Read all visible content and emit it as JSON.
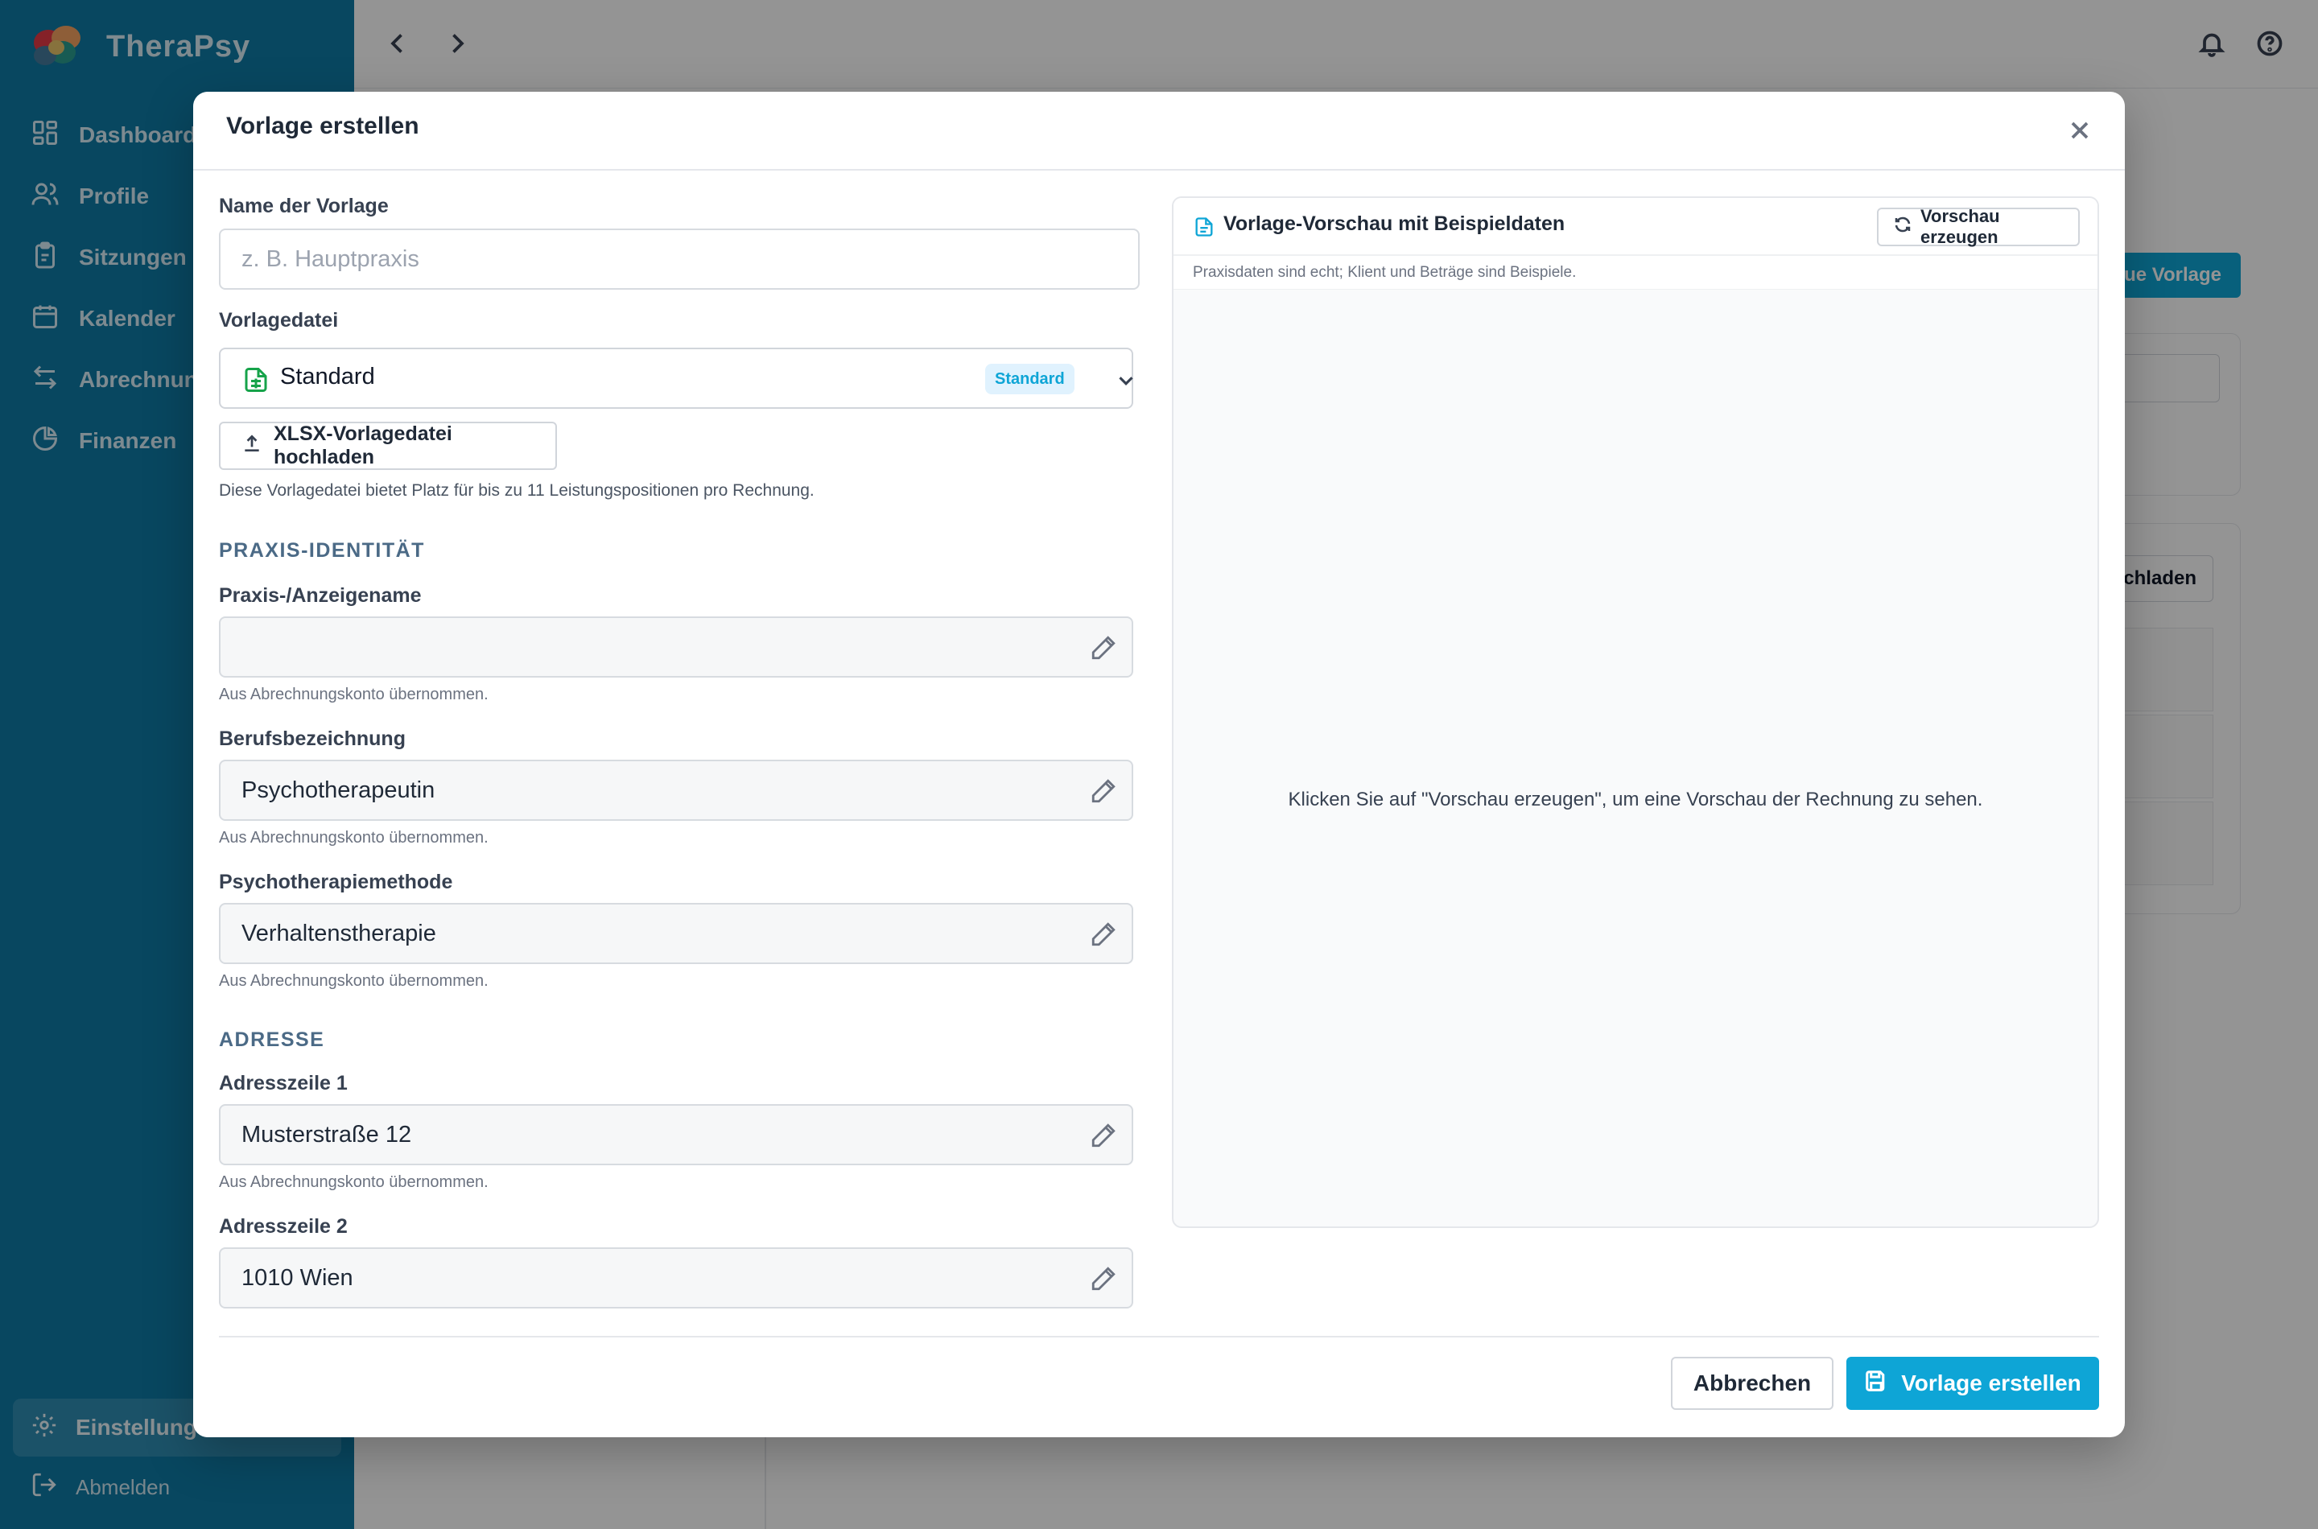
{
  "app": {
    "brand": "TheraPsy"
  },
  "sidebar": {
    "items": [
      {
        "label": "Dashboard",
        "icon": "dashboard-icon"
      },
      {
        "label": "Profile",
        "icon": "users-icon"
      },
      {
        "label": "Sitzungen",
        "icon": "clipboard-icon"
      },
      {
        "label": "Kalender",
        "icon": "calendar-icon"
      },
      {
        "label": "Abrechnung",
        "icon": "arrows-icon"
      },
      {
        "label": "Finanzen",
        "icon": "pie-chart-icon"
      }
    ],
    "active_bottom": {
      "label": "Einstellung",
      "icon": "gear-icon"
    },
    "logout": {
      "label": "Abmelden",
      "icon": "logout-icon"
    }
  },
  "background": {
    "new_button_label": "ue Vorlage",
    "upload_button_label": "chladen"
  },
  "modal": {
    "title": "Vorlage erstellen",
    "name_label": "Name der Vorlage",
    "name_placeholder": "z. B. Hauptpraxis",
    "name_value": "",
    "template_label": "Vorlagedatei",
    "template_value": "Standard",
    "template_badge": "Standard",
    "upload_label": "XLSX-Vorlagedatei hochladen",
    "template_hint": "Diese Vorlagedatei bietet Platz für bis zu 11 Leistungspositionen pro Rechnung.",
    "section_identity": "PRAXIS-IDENTITÄT",
    "section_address": "ADRESSE",
    "fields": [
      {
        "label": "Praxis-/Anzeigename",
        "value": "",
        "hint": "Aus Abrechnungskonto übernommen."
      },
      {
        "label": "Berufsbezeichnung",
        "value": "Psychotherapeutin",
        "hint": "Aus Abrechnungskonto übernommen."
      },
      {
        "label": "Psychotherapiemethode",
        "value": "Verhaltenstherapie",
        "hint": "Aus Abrechnungskonto übernommen."
      },
      {
        "label": "Adresszeile 1",
        "value": "Musterstraße 12",
        "hint": "Aus Abrechnungskonto übernommen."
      },
      {
        "label": "Adresszeile 2",
        "value": "1010 Wien",
        "hint": ""
      }
    ],
    "preview": {
      "title": "Vorlage-Vorschau mit Beispieldaten",
      "button": "Vorschau erzeugen",
      "subtitle": "Praxisdaten sind echt; Klient und Beträge sind Beispiele.",
      "empty": "Klicken Sie auf \"Vorschau erzeugen\", um eine Vorschau der Rechnung zu sehen."
    },
    "cancel": "Abbrechen",
    "create": "Vorlage erstellen"
  },
  "colors": {
    "sidebar": "#0e7aa6",
    "accent": "#0ea5d6",
    "badge_bg": "#e0f2fe",
    "doc_icon": "#16a34a"
  }
}
